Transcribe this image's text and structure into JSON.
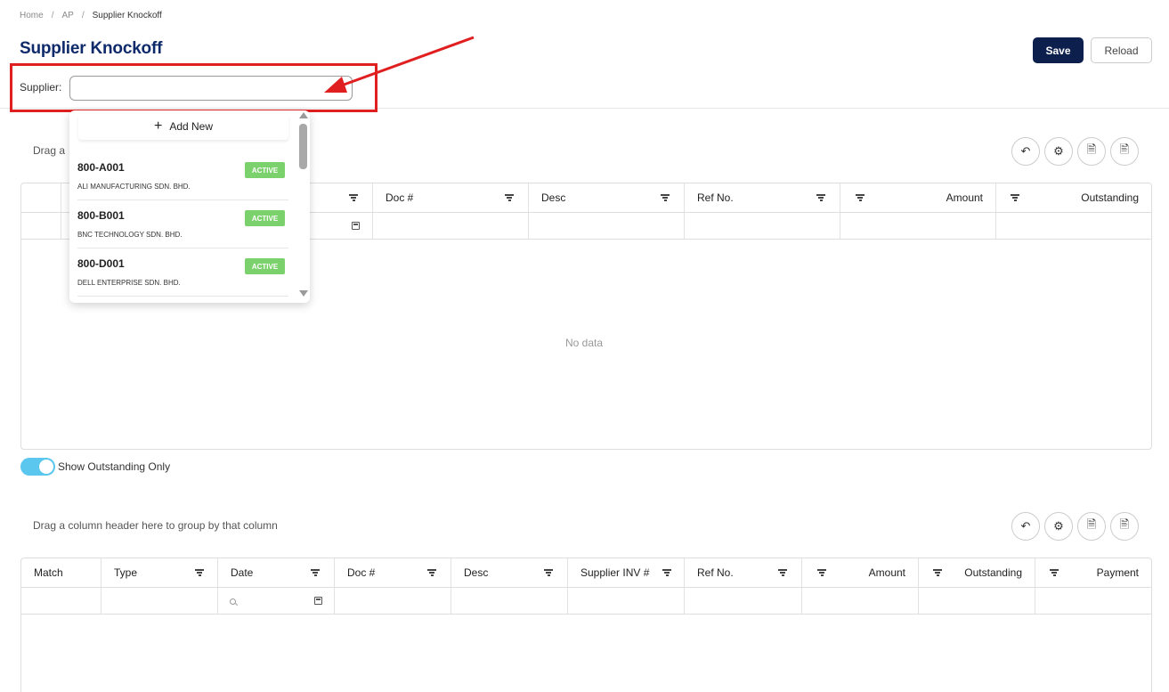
{
  "breadcrumb": {
    "home": "Home",
    "ap": "AP",
    "current": "Supplier Knockoff"
  },
  "page": {
    "title": "Supplier Knockoff"
  },
  "toolbar": {
    "save_label": "Save",
    "reload_label": "Reload"
  },
  "supplier": {
    "label": "Supplier:",
    "value": ""
  },
  "dropdown": {
    "add_new_label": "Add New",
    "items": [
      {
        "code": "800-A001",
        "name": "ALI MANUFACTURING SDN. BHD.",
        "status": "ACTIVE"
      },
      {
        "code": "800-B001",
        "name": "BNC TECHNOLOGY SDN. BHD.",
        "status": "ACTIVE"
      },
      {
        "code": "800-D001",
        "name": "DELL ENTERPRISE SDN. BHD.",
        "status": "ACTIVE"
      }
    ]
  },
  "grid1": {
    "group_hint": "Drag a",
    "columns": [
      "Doc #",
      "Desc",
      "Ref No.",
      "Amount",
      "Outstanding"
    ],
    "empty_text": "No data"
  },
  "toggle": {
    "label": "Show Outstanding Only",
    "on": true
  },
  "grid2": {
    "group_hint": "Drag a column header here to group by that column",
    "columns": [
      "Match",
      "Type",
      "Date",
      "Doc #",
      "Desc",
      "Supplier INV #",
      "Ref No.",
      "Amount",
      "Outstanding",
      "Payment"
    ]
  },
  "colors": {
    "brand": "#0f2a6b",
    "save_bg": "#0c1f4d",
    "active_badge": "#7bd16b",
    "toggle_on": "#5bc7ef",
    "annotation": "#e02020"
  },
  "icons": {
    "undo": "undo-icon",
    "settings": "gear-icon",
    "export_excel": "export-excel-icon",
    "export_pdf": "export-pdf-icon"
  }
}
